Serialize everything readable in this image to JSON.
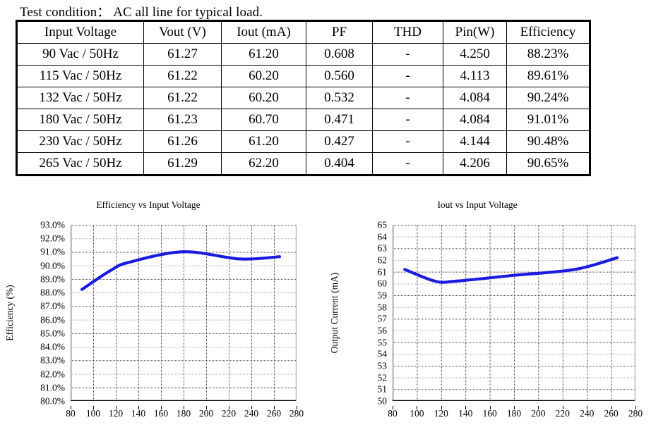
{
  "heading": {
    "test_condition": "Test condition： AC all line for typical load."
  },
  "table": {
    "columns": [
      "Input Voltage",
      "Vout (V)",
      "Iout (mA)",
      "PF",
      "THD",
      "Pin(W)",
      "Efficiency"
    ],
    "rows": [
      [
        "90 Vac / 50Hz",
        "61.27",
        "61.20",
        "0.608",
        "-",
        "4.250",
        "88.23%"
      ],
      [
        "115 Vac / 50Hz",
        "61.22",
        "60.20",
        "0.560",
        "-",
        "4.113",
        "89.61%"
      ],
      [
        "132 Vac / 50Hz",
        "61.22",
        "60.20",
        "0.532",
        "-",
        "4.084",
        "90.24%"
      ],
      [
        "180 Vac / 50Hz",
        "61.23",
        "60.70",
        "0.471",
        "-",
        "4.084",
        "91.01%"
      ],
      [
        "230 Vac / 50Hz",
        "61.26",
        "61.20",
        "0.427",
        "-",
        "4.144",
        "90.48%"
      ],
      [
        "265 Vac / 50Hz",
        "61.29",
        "62.20",
        "0.404",
        "-",
        "4.206",
        "90.65%"
      ]
    ]
  },
  "colors": {
    "line": "#1a1ae0",
    "grid_dark": "#3f3f3f",
    "grid_light": "#a8a8a8",
    "axis": "#7f7f7f",
    "text": "#000000"
  },
  "chart_data": [
    {
      "id": "efficiency",
      "type": "line",
      "title": "Efficiency vs Input Voltage",
      "xlabel": "",
      "ylabel": "Efficiency (%)",
      "x": [
        90,
        115,
        132,
        180,
        230,
        265
      ],
      "values": [
        88.23,
        89.61,
        90.24,
        91.01,
        90.48,
        90.65
      ],
      "xlim": [
        80,
        280
      ],
      "ylim": [
        80.0,
        93.0
      ],
      "xticks": [
        80,
        100,
        120,
        140,
        160,
        180,
        200,
        220,
        240,
        260,
        280
      ],
      "xtick_labels": [
        "80",
        "100",
        "120",
        "140",
        "160",
        "180",
        "200",
        "220",
        "240",
        "260",
        "280"
      ],
      "yticks": [
        80.0,
        81.0,
        82.0,
        83.0,
        84.0,
        85.0,
        86.0,
        87.0,
        88.0,
        89.0,
        90.0,
        91.0,
        92.0,
        93.0
      ],
      "ytick_labels": [
        "80.0%",
        "81.0%",
        "82.0%",
        "83.0%",
        "84.0%",
        "85.0%",
        "86.0%",
        "87.0%",
        "88.0%",
        "89.0%",
        "90.0%",
        "91.0%",
        "92.0%",
        "93.0%"
      ],
      "grid": true,
      "legend": "none",
      "smooth": true
    },
    {
      "id": "iout",
      "type": "line",
      "title": "Iout vs Input Voltage",
      "xlabel": "",
      "ylabel": "Output Current (mA)",
      "x": [
        90,
        115,
        132,
        180,
        230,
        265
      ],
      "values": [
        61.2,
        60.2,
        60.2,
        60.7,
        61.2,
        62.2
      ],
      "xlim": [
        80,
        280
      ],
      "ylim": [
        50,
        65
      ],
      "xticks": [
        80,
        100,
        120,
        140,
        160,
        180,
        200,
        220,
        240,
        260,
        280
      ],
      "xtick_labels": [
        "80",
        "100",
        "120",
        "140",
        "160",
        "180",
        "200",
        "220",
        "240",
        "260",
        "280"
      ],
      "yticks": [
        50,
        51,
        52,
        53,
        54,
        55,
        56,
        57,
        58,
        59,
        60,
        61,
        62,
        63,
        64,
        65
      ],
      "ytick_labels": [
        "50",
        "51",
        "52",
        "53",
        "54",
        "55",
        "56",
        "57",
        "58",
        "59",
        "60",
        "61",
        "62",
        "63",
        "64",
        "65"
      ],
      "grid": true,
      "legend": "none",
      "smooth": true
    }
  ]
}
